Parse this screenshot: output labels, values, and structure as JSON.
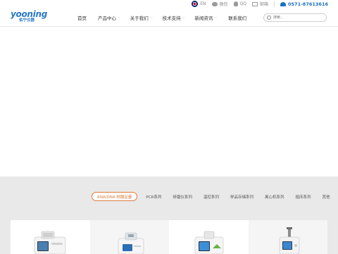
{
  "topbar": {
    "language": "EN",
    "wechat": "微信",
    "qq": "QQ",
    "mail": "邮箱",
    "phone": "0571-87613616"
  },
  "logo": {
    "name": "yooning",
    "sub": "佑宁仪器"
  },
  "nav": {
    "items": [
      {
        "label": "首页",
        "has_dropdown": false
      },
      {
        "label": "产品中心",
        "has_dropdown": true
      },
      {
        "label": "关于我们",
        "has_dropdown": true
      },
      {
        "label": "技术支持",
        "has_dropdown": true
      },
      {
        "label": "新闻资讯",
        "has_dropdown": true
      },
      {
        "label": "联系我们",
        "has_dropdown": false
      }
    ]
  },
  "search": {
    "placeholder": "搜索..."
  },
  "products": {
    "tabs": [
      {
        "label": "RNA/DNA 核酸定量",
        "active": true
      },
      {
        "label": "PCR系列",
        "active": false
      },
      {
        "label": "研磨仪系列",
        "active": false
      },
      {
        "label": "温控系列",
        "active": false
      },
      {
        "label": "样品存储系列",
        "active": false
      },
      {
        "label": "离心机系列",
        "active": false
      },
      {
        "label": "摇床系列",
        "active": false
      },
      {
        "label": "其他",
        "active": false
      }
    ],
    "cards": [
      {
        "device": "spectrophotometer-device"
      },
      {
        "device": "mini-spectrophotometer-device"
      },
      {
        "device": "touchscreen-analyzer-device"
      },
      {
        "device": "homogenizer-device"
      }
    ]
  },
  "colors": {
    "brand": "#2a78c8",
    "accent": "#e07a3a",
    "phone": "#1a6fc4",
    "section_bg": "#e9e9e9"
  }
}
